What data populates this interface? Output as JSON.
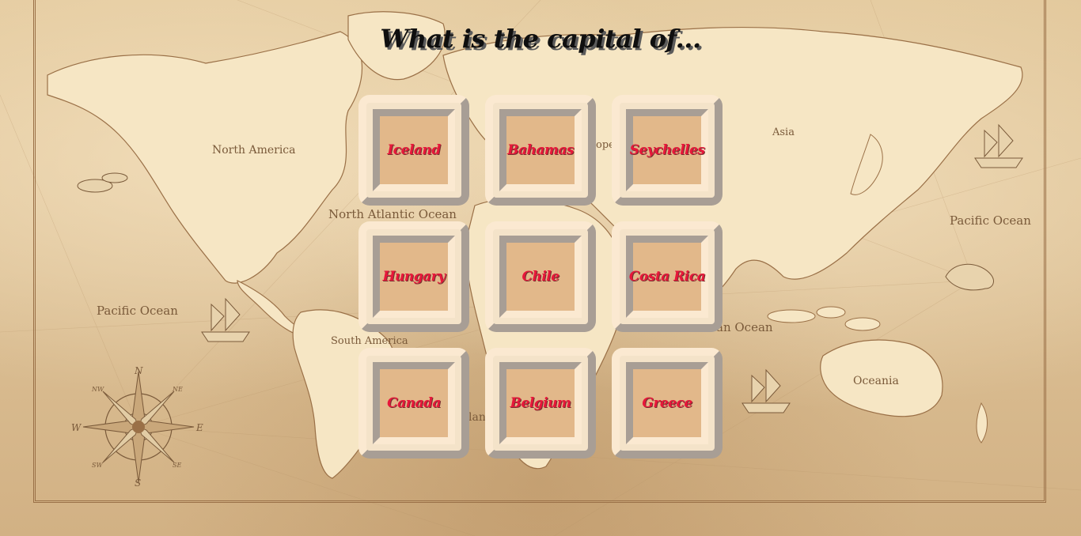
{
  "question": {
    "prompt": "What is the capital of..."
  },
  "tiles": [
    {
      "label": "Iceland"
    },
    {
      "label": "Bahamas"
    },
    {
      "label": "Seychelles"
    },
    {
      "label": "Hungary"
    },
    {
      "label": "Chile"
    },
    {
      "label": "Costa Rica"
    },
    {
      "label": "Canada"
    },
    {
      "label": "Belgium"
    },
    {
      "label": "Greece"
    }
  ],
  "map": {
    "labels": {
      "north_america": "North America",
      "south_america": "South America",
      "asia": "Asia",
      "europe": "ope",
      "oceania": "Oceania",
      "north_atlantic": "North Atlantic Ocean",
      "pacific_west": "Pacific Ocean",
      "pacific_east": "Pacific Ocean",
      "indian": "an Ocean",
      "africa_fragment": "lan"
    },
    "compass": {
      "n": "N",
      "s": "S",
      "e": "E",
      "w": "W",
      "ne": "NE",
      "nw": "NW",
      "se": "SE",
      "sw": "SW"
    }
  },
  "colors": {
    "parchment": "#dcc095",
    "land": "#f6e6c4",
    "tile_face": "#e2b88a",
    "tile_label": "#e8173a",
    "title": "#0f0f0f"
  }
}
